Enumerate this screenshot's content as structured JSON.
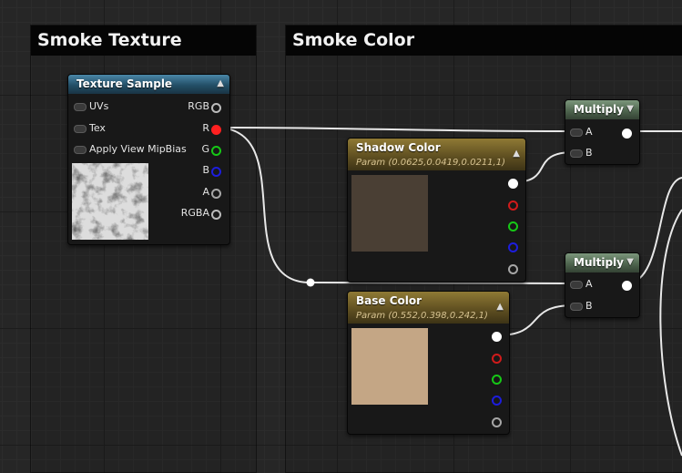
{
  "comments": {
    "smoke_texture": "Smoke Texture",
    "smoke_color": "Smoke Color"
  },
  "texture_sample": {
    "title": "Texture Sample",
    "inputs": [
      "UVs",
      "Tex",
      "Apply View MipBias"
    ],
    "outputs": [
      "RGB",
      "R",
      "G",
      "B",
      "A",
      "RGBA"
    ]
  },
  "shadow_color": {
    "title": "Shadow Color",
    "param": "Param (0.0625,0.0419,0.0211,1)",
    "swatch": "#4a3f34"
  },
  "base_color": {
    "title": "Base Color",
    "param": "Param (0.552,0.398,0.242,1)",
    "swatch": "#c4a685"
  },
  "multiply_top": {
    "title": "Multiply",
    "inputs": [
      "A",
      "B"
    ]
  },
  "multiply_bottom": {
    "title": "Multiply",
    "inputs": [
      "A",
      "B"
    ]
  },
  "colors": {
    "texture_header": "#234f67",
    "param_header": "#5c4d20",
    "math_header": "#4b614b",
    "wire": "#e8e8e8"
  },
  "icons": {
    "collapse": "chevron-up-icon",
    "expand": "chevron-down-icon"
  }
}
